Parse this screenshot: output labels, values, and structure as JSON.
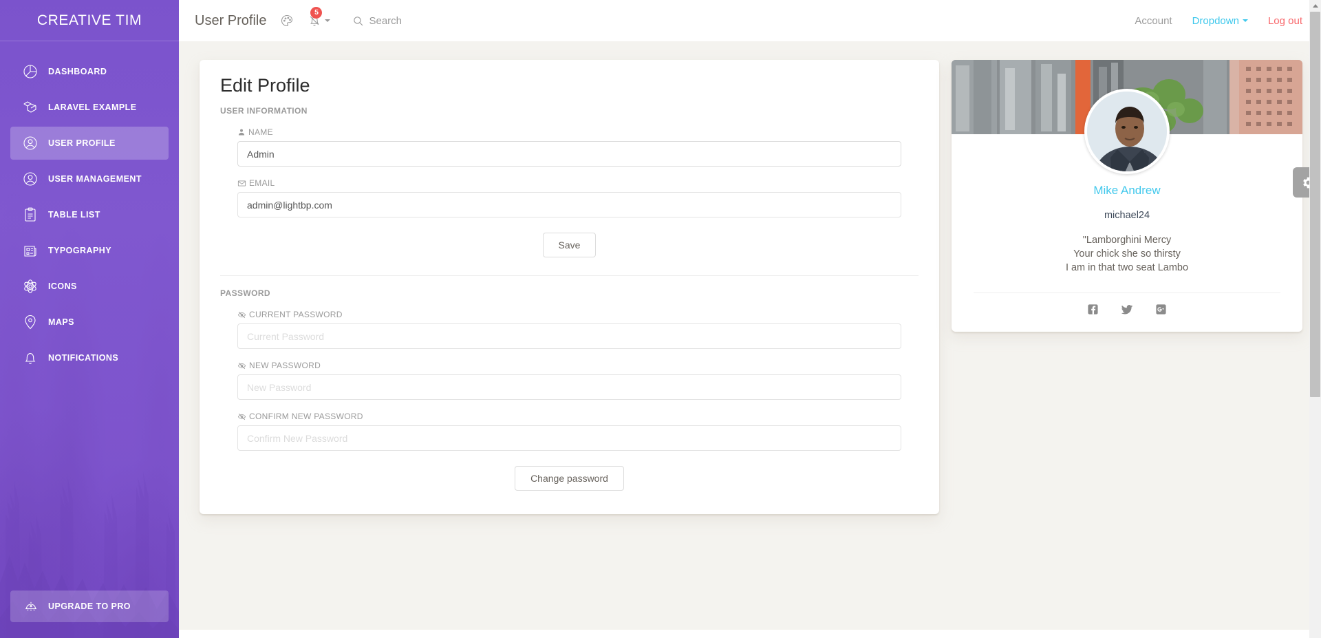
{
  "sidebar": {
    "brand": "CREATIVE TIM",
    "items": [
      {
        "label": "Dashboard",
        "icon": "pie-chart-icon",
        "active": false
      },
      {
        "label": "Laravel example",
        "icon": "laravel-icon",
        "active": false
      },
      {
        "label": "User profile",
        "icon": "user-circle-icon",
        "active": true
      },
      {
        "label": "User Management",
        "icon": "users-circle-icon",
        "active": false
      },
      {
        "label": "Table List",
        "icon": "clipboard-list-icon",
        "active": false
      },
      {
        "label": "Typography",
        "icon": "newspaper-icon",
        "active": false
      },
      {
        "label": "Icons",
        "icon": "atom-icon",
        "active": false
      },
      {
        "label": "Maps",
        "icon": "map-pin-icon",
        "active": false
      },
      {
        "label": "Notifications",
        "icon": "bell-icon",
        "active": false
      }
    ],
    "upgrade": {
      "label": "Upgrade to pro",
      "icon": "bell-dome-icon"
    }
  },
  "navbar": {
    "title": "User Profile",
    "palette_icon": "palette-icon",
    "notifications_icon": "bell-slash-icon",
    "notifications_badge": "5",
    "search_label": "Search",
    "search_icon": "search-icon",
    "links": [
      {
        "label": "Account",
        "style": "muted",
        "caret": false
      },
      {
        "label": "Dropdown",
        "style": "accent",
        "caret": true
      },
      {
        "label": "Log out",
        "style": "danger",
        "caret": false
      }
    ]
  },
  "edit_profile": {
    "title": "Edit Profile",
    "user_information_label": "User Information",
    "password_label": "Password",
    "fields": [
      {
        "label": "Name",
        "icon": "user-icon",
        "value": "Admin",
        "placeholder": "Name",
        "focused": true
      },
      {
        "label": "Email",
        "icon": "envelope-icon",
        "value": "admin@lightbp.com",
        "placeholder": "Email",
        "focused": false
      }
    ],
    "save_button": "Save",
    "password_fields": [
      {
        "label": "Current Password",
        "icon": "eye-slash-icon",
        "placeholder": "Current Password",
        "value": ""
      },
      {
        "label": "New Password",
        "icon": "eye-slash-icon",
        "placeholder": "New Password",
        "value": ""
      },
      {
        "label": "Confirm New Password",
        "icon": "eye-slash-icon",
        "placeholder": "Confirm New Password",
        "value": ""
      }
    ],
    "change_password_button": "Change password"
  },
  "profile_card": {
    "name": "Mike Andrew",
    "handle": "michael24",
    "quote_lines": [
      "\"Lamborghini Mercy",
      "Your chick she so thirsty",
      "I am in that two seat Lambo"
    ],
    "socials": [
      {
        "name": "facebook-icon"
      },
      {
        "name": "twitter-icon"
      },
      {
        "name": "google-plus-icon"
      }
    ]
  },
  "settings_tab": {
    "icon": "gear-icon"
  },
  "colors": {
    "sidebar_purple": "#7b53cc",
    "accent_cyan": "#42c8ec",
    "danger_red": "#f8666a",
    "badge_red": "#ef5350",
    "content_bg": "#f4f3ef",
    "text_muted": "#9a9a9a"
  }
}
